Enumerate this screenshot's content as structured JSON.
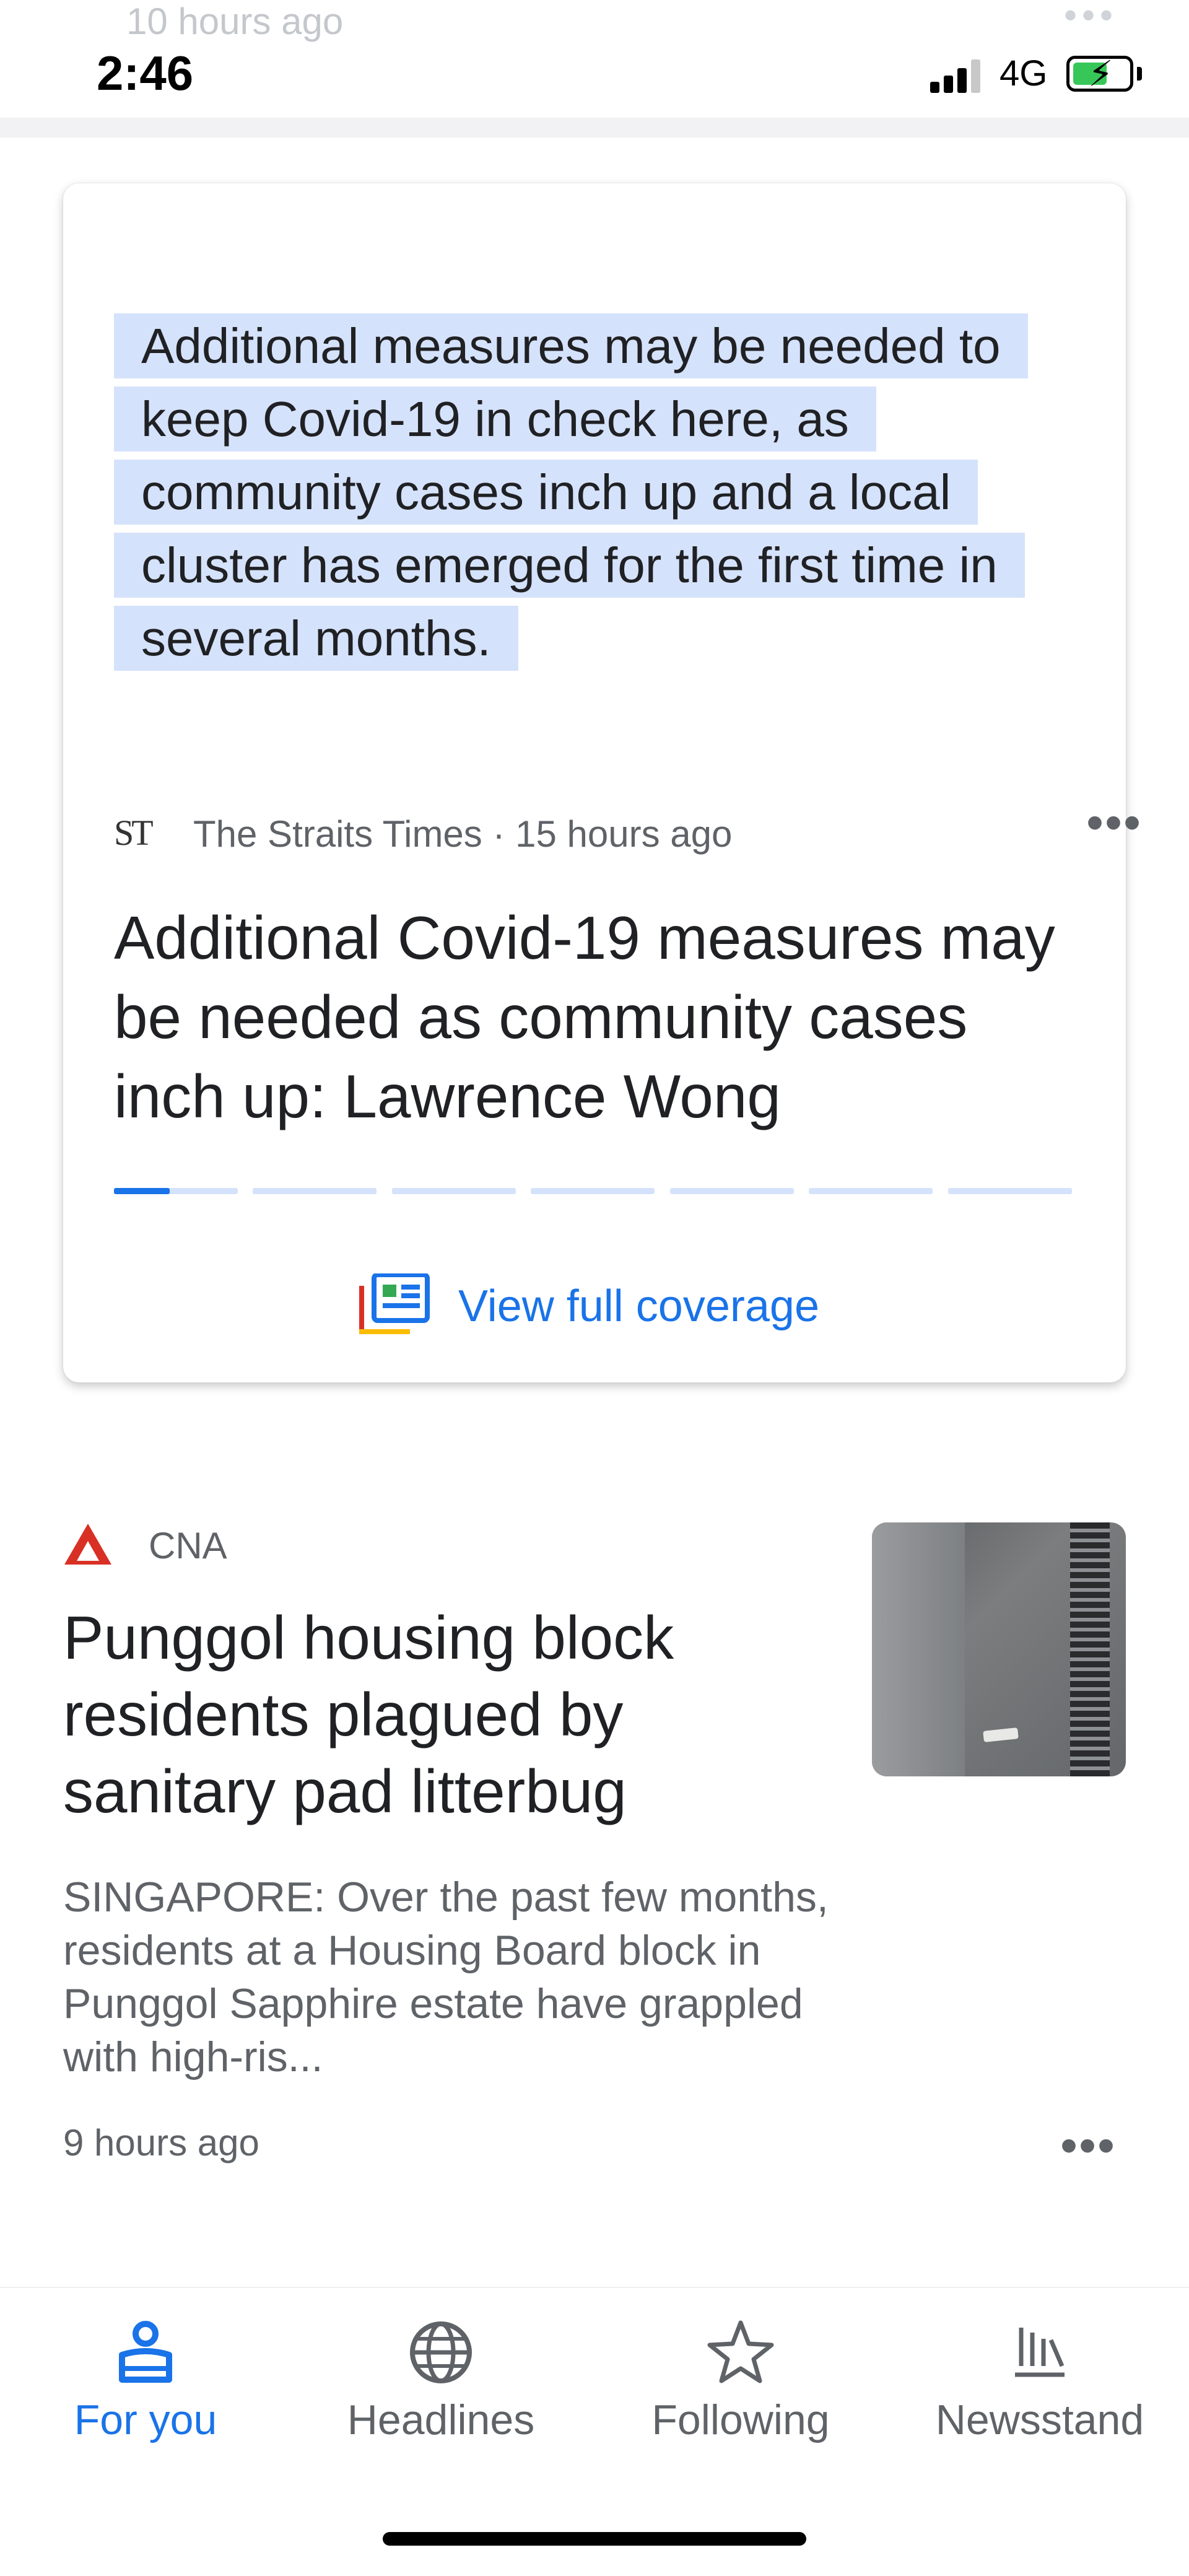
{
  "status_bar": {
    "ghost_text": "10 hours ago",
    "time": "2:46",
    "network": "4G",
    "battery_charging": true
  },
  "card": {
    "quote": "Additional measures may be needed to keep Covid-19 in check here, as community cases inch up and a local cluster has emerged for the first time in several months.",
    "source_logo": "ST",
    "source_meta": "The Straits Times · 15 hours ago",
    "title": "Additional Covid-19 measures may be needed as community cases inch up: Lawrence Wong",
    "carousel": {
      "total": 7,
      "current": 1
    },
    "coverage_label": "View full coverage"
  },
  "article": {
    "source": "CNA",
    "title": "Punggol housing block residents plagued by sanitary pad litterbug",
    "snippet": "SINGAPORE: Over the past few months, residents at a Housing Board block in Punggol Sapphire estate have grappled with high-ris...",
    "time": "9 hours ago"
  },
  "bottom_nav": {
    "items": [
      {
        "label": "For you",
        "icon": "for-you-icon",
        "active": true
      },
      {
        "label": "Headlines",
        "icon": "globe-icon",
        "active": false
      },
      {
        "label": "Following",
        "icon": "star-icon",
        "active": false
      },
      {
        "label": "Newsstand",
        "icon": "newsstand-icon",
        "active": false
      }
    ]
  },
  "colors": {
    "accent": "#1a73e8",
    "highlight": "#d5e2fb",
    "cna_red": "#d93025",
    "text_primary": "#202124",
    "text_secondary": "#5f6368"
  }
}
